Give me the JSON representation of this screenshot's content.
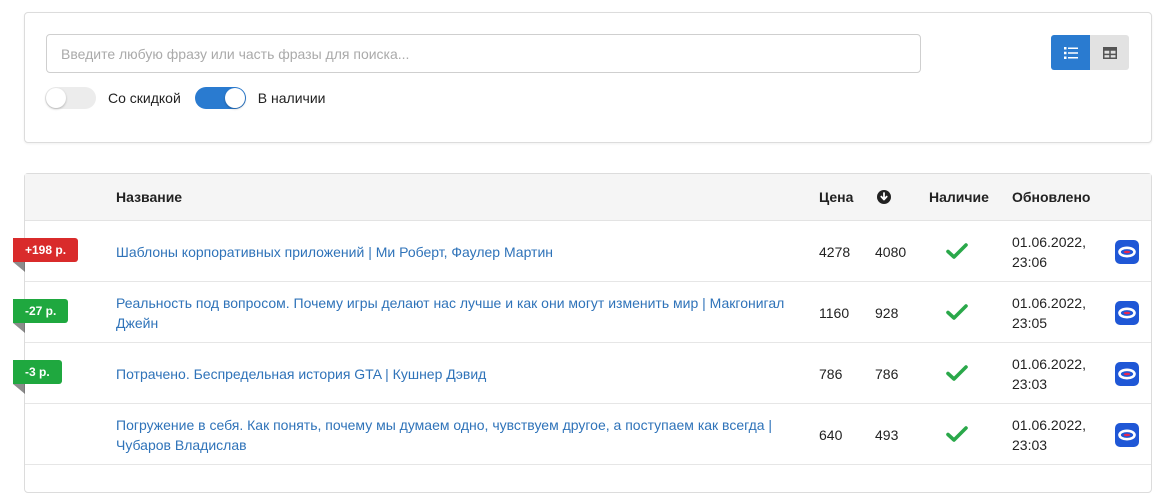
{
  "search": {
    "placeholder": "Введите любую фразу или часть фразы для поиска...",
    "value": "",
    "toggle_discount": {
      "label": "Со скидкой",
      "on": false
    },
    "toggle_available": {
      "label": "В наличии",
      "on": true
    },
    "view_modes": [
      {
        "name": "list-view",
        "icon": "list-icon",
        "active": true
      },
      {
        "name": "table-view",
        "icon": "table-icon",
        "active": false
      }
    ]
  },
  "table": {
    "headers": {
      "name": "Название",
      "price": "Цена",
      "min_price_icon": "arrow-down-circle-icon",
      "availability": "Наличие",
      "updated": "Обновлено"
    },
    "rows": [
      {
        "badge": "+198 р.",
        "badge_type": "up",
        "title": "Шаблоны корпоративных приложений | Ми Роберт, Фаулер Мартин",
        "price": "4278",
        "min_price": "4080",
        "in_stock": true,
        "updated_date": "01.06.2022,",
        "updated_time": "23:06",
        "shop_icon": "ozon-icon"
      },
      {
        "badge": "-27 р.",
        "badge_type": "down",
        "title": "Реальность под вопросом. Почему игры делают нас лучше и как они могут изменить мир | Макгонигал Джейн",
        "price": "1160",
        "min_price": "928",
        "in_stock": true,
        "updated_date": "01.06.2022,",
        "updated_time": "23:05",
        "shop_icon": "ozon-icon"
      },
      {
        "badge": "-3 р.",
        "badge_type": "down",
        "title": "Потрачено. Беспредельная история GTA | Кушнер Дэвид",
        "price": "786",
        "min_price": "786",
        "in_stock": true,
        "updated_date": "01.06.2022,",
        "updated_time": "23:03",
        "shop_icon": "ozon-icon"
      },
      {
        "badge": "",
        "badge_type": "none",
        "title": "Погружение в себя. Как понять, почему мы думаем одно, чувствуем другое, а поступаем как всегда | Чубаров Владислав",
        "price": "640",
        "min_price": "493",
        "in_stock": true,
        "updated_date": "01.06.2022,",
        "updated_time": "23:03",
        "shop_icon": "ozon-icon"
      }
    ]
  },
  "colors": {
    "accent": "#2a7bd0",
    "link": "#2f73b9",
    "badge_up": "#d92b2b",
    "badge_down": "#1fa83f",
    "check": "#2aa84a",
    "shop_icon_bg": "#1f57d6"
  }
}
